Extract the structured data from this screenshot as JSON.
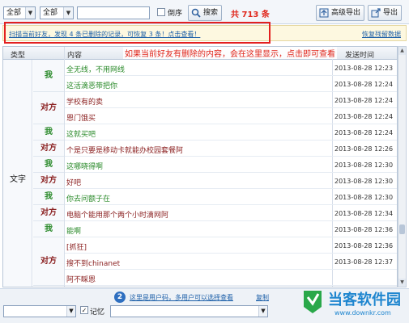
{
  "toolbar": {
    "filter1": "全部",
    "filter2": "全部",
    "search_value": "",
    "reverse_label": "倒序",
    "search_label": "搜索",
    "count": "共 713 条",
    "export_adv_label": "高级导出",
    "export_label": "导出"
  },
  "banner": {
    "text": "扫描当前好友，发现 4 条已删除的记录，可恢复 3 条！点击查看！",
    "link": "恢复残留数据"
  },
  "annotation": "如果当前好友有删除的内容，会在这里显示，点击即可查看",
  "table": {
    "headers": {
      "type": "类型",
      "content": "内容",
      "time": "发送时间"
    },
    "type_value": "文字",
    "senders": [
      {
        "label": "我",
        "kind": "me",
        "rows": 2
      },
      {
        "label": "对方",
        "kind": "other",
        "rows": 2
      },
      {
        "label": "我",
        "kind": "me",
        "rows": 1
      },
      {
        "label": "对方",
        "kind": "other",
        "rows": 1
      },
      {
        "label": "我",
        "kind": "me",
        "rows": 1
      },
      {
        "label": "对方",
        "kind": "other",
        "rows": 1
      },
      {
        "label": "我",
        "kind": "me",
        "rows": 1
      },
      {
        "label": "对方",
        "kind": "other",
        "rows": 1
      },
      {
        "label": "我",
        "kind": "me",
        "rows": 1
      },
      {
        "label": "对方",
        "kind": "other",
        "rows": 3
      }
    ],
    "rows": [
      {
        "msg": "全无线，不用网线",
        "kind": "me",
        "time": "2013-08-28 12:23"
      },
      {
        "msg": "这活滴恶带把你",
        "kind": "me",
        "time": "2013-08-28 12:24"
      },
      {
        "msg": "学校有的卖",
        "kind": "other",
        "time": "2013-08-28 12:24"
      },
      {
        "msg": "恩门饿买",
        "kind": "other",
        "time": "2013-08-28 12:24"
      },
      {
        "msg": "这就买吧",
        "kind": "me",
        "time": "2013-08-28 12:24"
      },
      {
        "msg": "个是只要是移动卡就能办校园套餐阿",
        "kind": "other",
        "time": "2013-08-28 12:26"
      },
      {
        "msg": "这哪晓得啊",
        "kind": "me",
        "time": "2013-08-28 12:30"
      },
      {
        "msg": "好吧",
        "kind": "other",
        "time": "2013-08-28 12:30"
      },
      {
        "msg": "你去问额子在",
        "kind": "me",
        "time": "2013-08-28 12:30"
      },
      {
        "msg": "电脑个能用那个两个小时滴网阿",
        "kind": "other",
        "time": "2013-08-28 12:34"
      },
      {
        "msg": "能啊",
        "kind": "me",
        "time": "2013-08-28 12:36"
      },
      {
        "msg": "[抓狂]",
        "kind": "other",
        "time": "2013-08-28 12:36"
      },
      {
        "msg": "搜不到chinanet",
        "kind": "other",
        "time": "2013-08-28 12:37"
      },
      {
        "msg": "阿不睬恩",
        "kind": "other",
        "time": ""
      }
    ]
  },
  "bottom": {
    "step": "2",
    "tip": "这里是用户码，多用户可以选择查看",
    "tip_link": "复制",
    "remember_label": "记忆"
  },
  "watermark": {
    "title": "当客软件园",
    "url": "www.downkr.com"
  },
  "colors": {
    "accent_red": "#e0261b",
    "link_blue": "#1c5fa8",
    "me_green": "#2a8a2a",
    "other_red": "#8a1f1f",
    "watermark_blue": "#1f86cf"
  }
}
